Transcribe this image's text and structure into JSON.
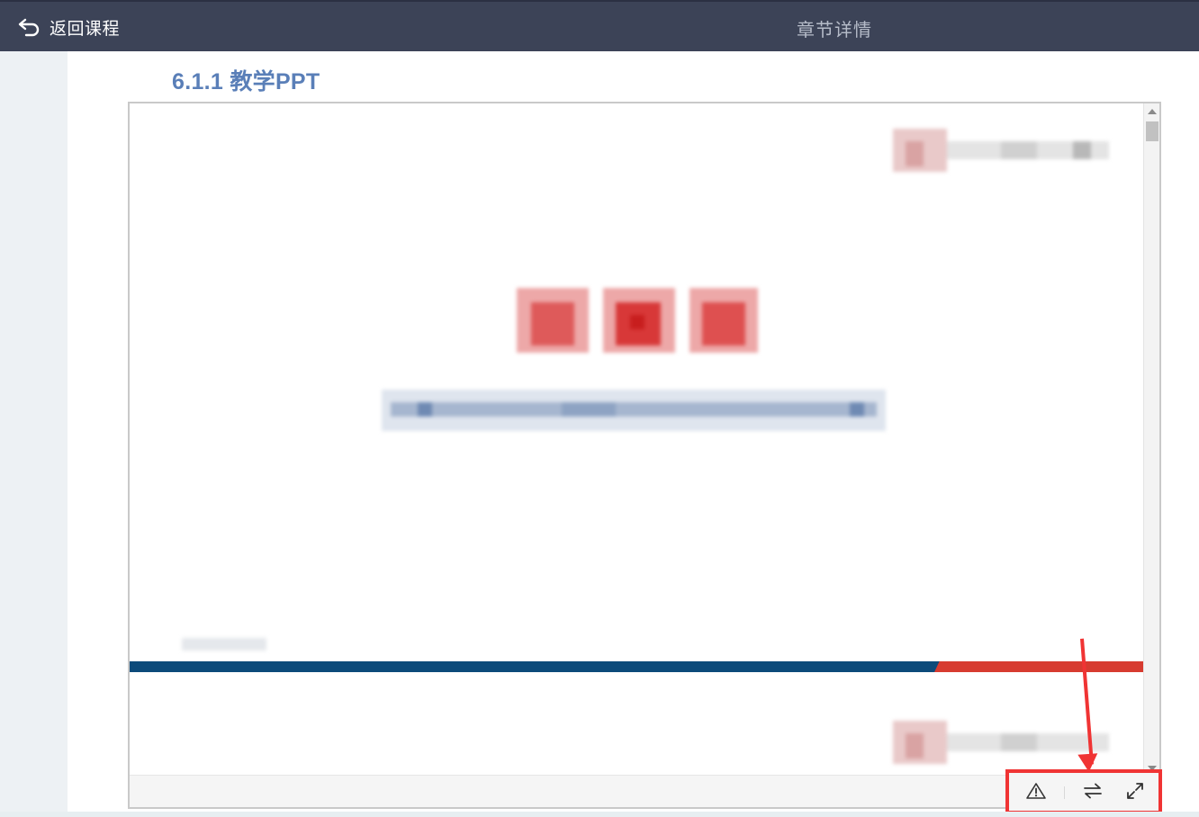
{
  "header": {
    "back_label": "返回课程",
    "title": "章节详情"
  },
  "main": {
    "section_title": "6.1.1 教学PPT"
  },
  "viewer": {
    "toolbar": {
      "icons": [
        "warning-icon",
        "swap-icon",
        "fullscreen-icon"
      ]
    }
  },
  "colors": {
    "header_bg": "#3c4357",
    "title_blue": "#5a7fb8",
    "stripe_blue": "#0c4a7a",
    "stripe_red": "#d73b30",
    "highlight_red": "#f03434"
  }
}
